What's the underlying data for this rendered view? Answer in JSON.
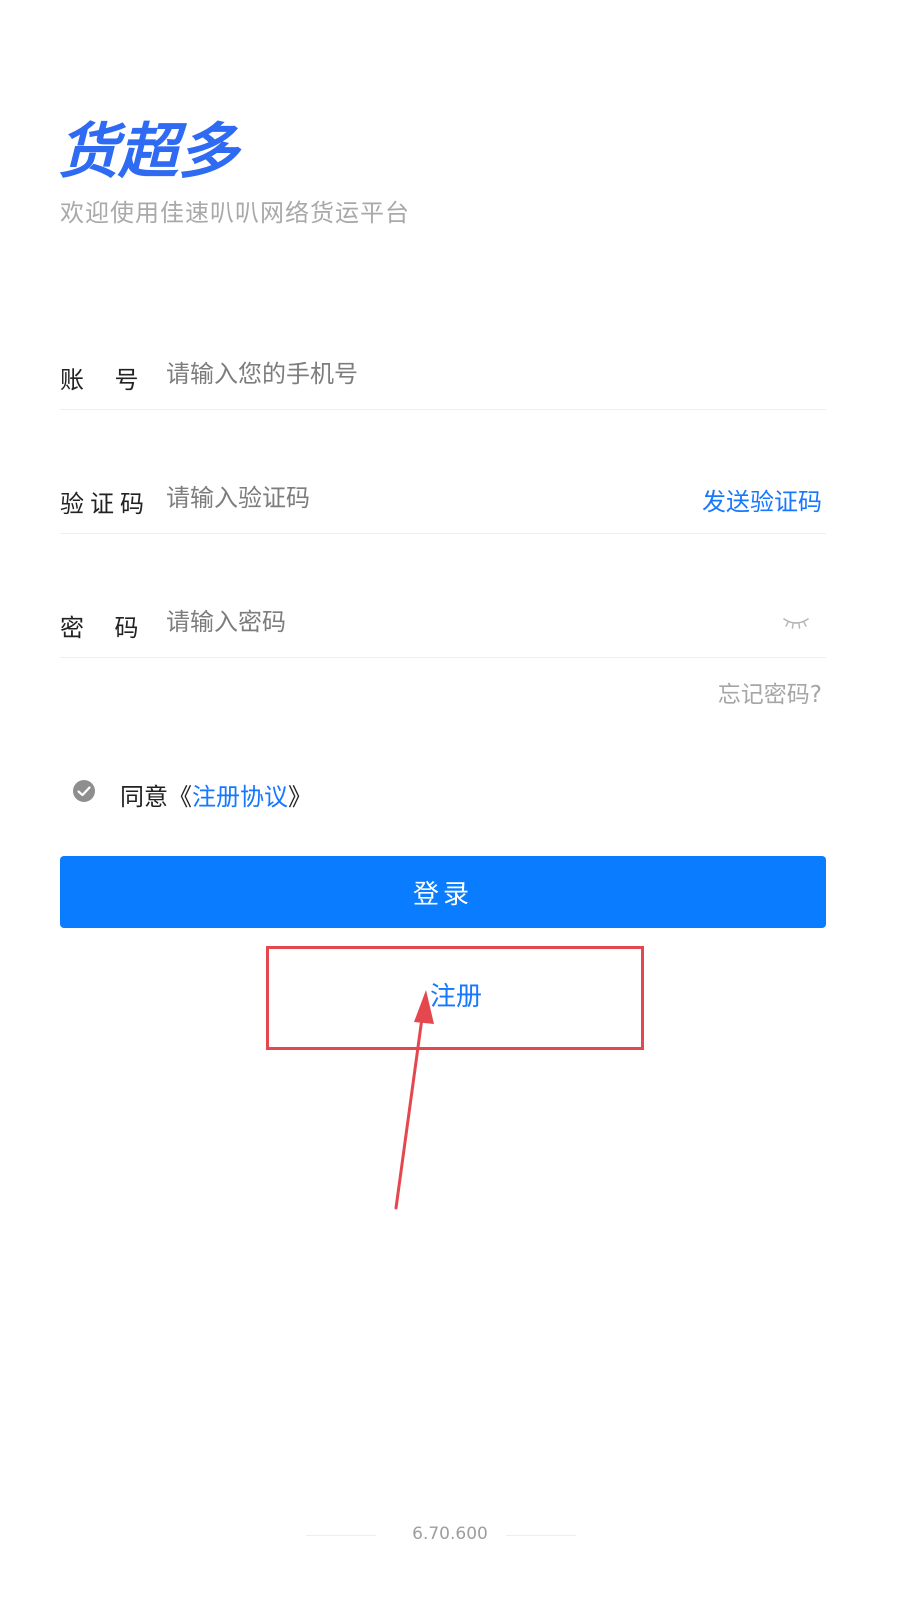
{
  "app": {
    "logo_text": "货超多",
    "subtitle": "欢迎使用佳速叭叭网络货运平台"
  },
  "form": {
    "account": {
      "label": "账    号",
      "placeholder": "请输入您的手机号",
      "value": ""
    },
    "code": {
      "label": "验证码",
      "placeholder": "请输入验证码",
      "value": "",
      "send_label": "发送验证码"
    },
    "password": {
      "label": "密    码",
      "placeholder": "请输入密码",
      "value": "",
      "visibility_icon": "eye-closed-icon"
    },
    "forgot_label": "忘记密码?"
  },
  "agreement": {
    "prefix": "同意《",
    "link_label": "注册协议",
    "suffix": "》",
    "checked": true
  },
  "actions": {
    "login_label": "登录",
    "register_label": "注册"
  },
  "footer": {
    "version": "6.70.600"
  },
  "colors": {
    "brand_blue": "#1677ff",
    "button_blue": "#0a7cff",
    "annotation_red": "#e4474d"
  }
}
